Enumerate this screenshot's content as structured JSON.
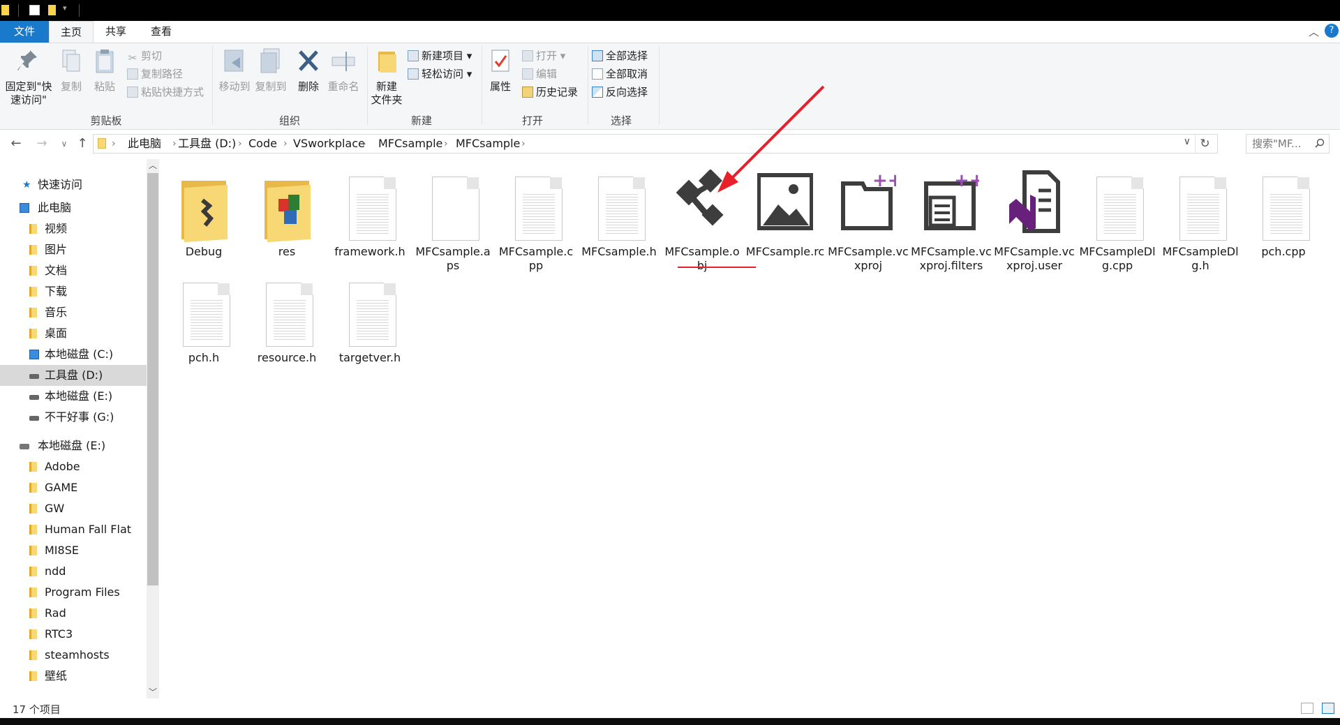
{
  "ribbon_tabs": {
    "file": "文件",
    "home": "主页",
    "share": "共享",
    "view": "查看"
  },
  "clipboard": {
    "pin": "固定到\"快速访问\"",
    "copy": "复制",
    "paste": "粘贴",
    "cut": "剪切",
    "copy_path": "复制路径",
    "paste_shortcut": "粘贴快捷方式",
    "label": "剪贴板"
  },
  "organize": {
    "move_to": "移动到",
    "copy_to": "复制到",
    "delete": "删除",
    "rename": "重命名",
    "label": "组织"
  },
  "new_group": {
    "new_folder": "新建\n文件夹",
    "new_item": "新建项目",
    "easy_access": "轻松访问",
    "label": "新建"
  },
  "open_group": {
    "properties": "属性",
    "open": "打开",
    "edit": "编辑",
    "history": "历史记录",
    "label": "打开"
  },
  "select_group": {
    "select_all": "全部选择",
    "select_none": "全部取消",
    "invert": "反向选择",
    "label": "选择"
  },
  "breadcrumb": [
    "此电脑",
    "工具盘 (D:)",
    "Code",
    "VSworkplace",
    "MFCsample",
    "MFCsample"
  ],
  "search": {
    "placeholder": "搜索\"MF..."
  },
  "nav": {
    "quick_access": "快速访问",
    "this_pc": "此电脑",
    "pc_items": [
      "视频",
      "图片",
      "文档",
      "下载",
      "音乐",
      "桌面",
      "本地磁盘 (C:)",
      "工具盘 (D:)",
      "本地磁盘 (E:)",
      "不干好事 (G:)"
    ],
    "drive_e": "本地磁盘 (E:)",
    "e_items": [
      "Adobe",
      "GAME",
      "GW",
      "Human Fall Flat",
      "MI8SE",
      "ndd",
      "Program Files",
      "Rad",
      "RTC3",
      "steamhosts",
      "壁纸"
    ]
  },
  "files": [
    {
      "name": "Debug",
      "kind": "folder-debug"
    },
    {
      "name": "res",
      "kind": "folder-res"
    },
    {
      "name": "framework.h",
      "kind": "doc"
    },
    {
      "name": "MFCsample.aps",
      "kind": "blank"
    },
    {
      "name": "MFCsample.cpp",
      "kind": "doc"
    },
    {
      "name": "MFCsample.h",
      "kind": "doc"
    },
    {
      "name": "MFCsample.obj",
      "kind": "obj"
    },
    {
      "name": "MFCsample.rc",
      "kind": "image"
    },
    {
      "name": "MFCsample.vcxproj",
      "kind": "vcxproj"
    },
    {
      "name": "MFCsample.vcxproj.filters",
      "kind": "filters"
    },
    {
      "name": "MFCsample.vcxproj.user",
      "kind": "vs"
    },
    {
      "name": "MFCsampleDlg.cpp",
      "kind": "doc"
    },
    {
      "name": "MFCsampleDlg.h",
      "kind": "doc"
    },
    {
      "name": "pch.cpp",
      "kind": "doc"
    },
    {
      "name": "pch.h",
      "kind": "doc"
    },
    {
      "name": "resource.h",
      "kind": "doc"
    },
    {
      "name": "targetver.h",
      "kind": "doc"
    }
  ],
  "status": {
    "count": "17 个项目"
  },
  "colors": {
    "accent": "#1979ca",
    "annotation": "#e8202a",
    "folder": "#f8d775",
    "vs_purple": "#68217a"
  }
}
